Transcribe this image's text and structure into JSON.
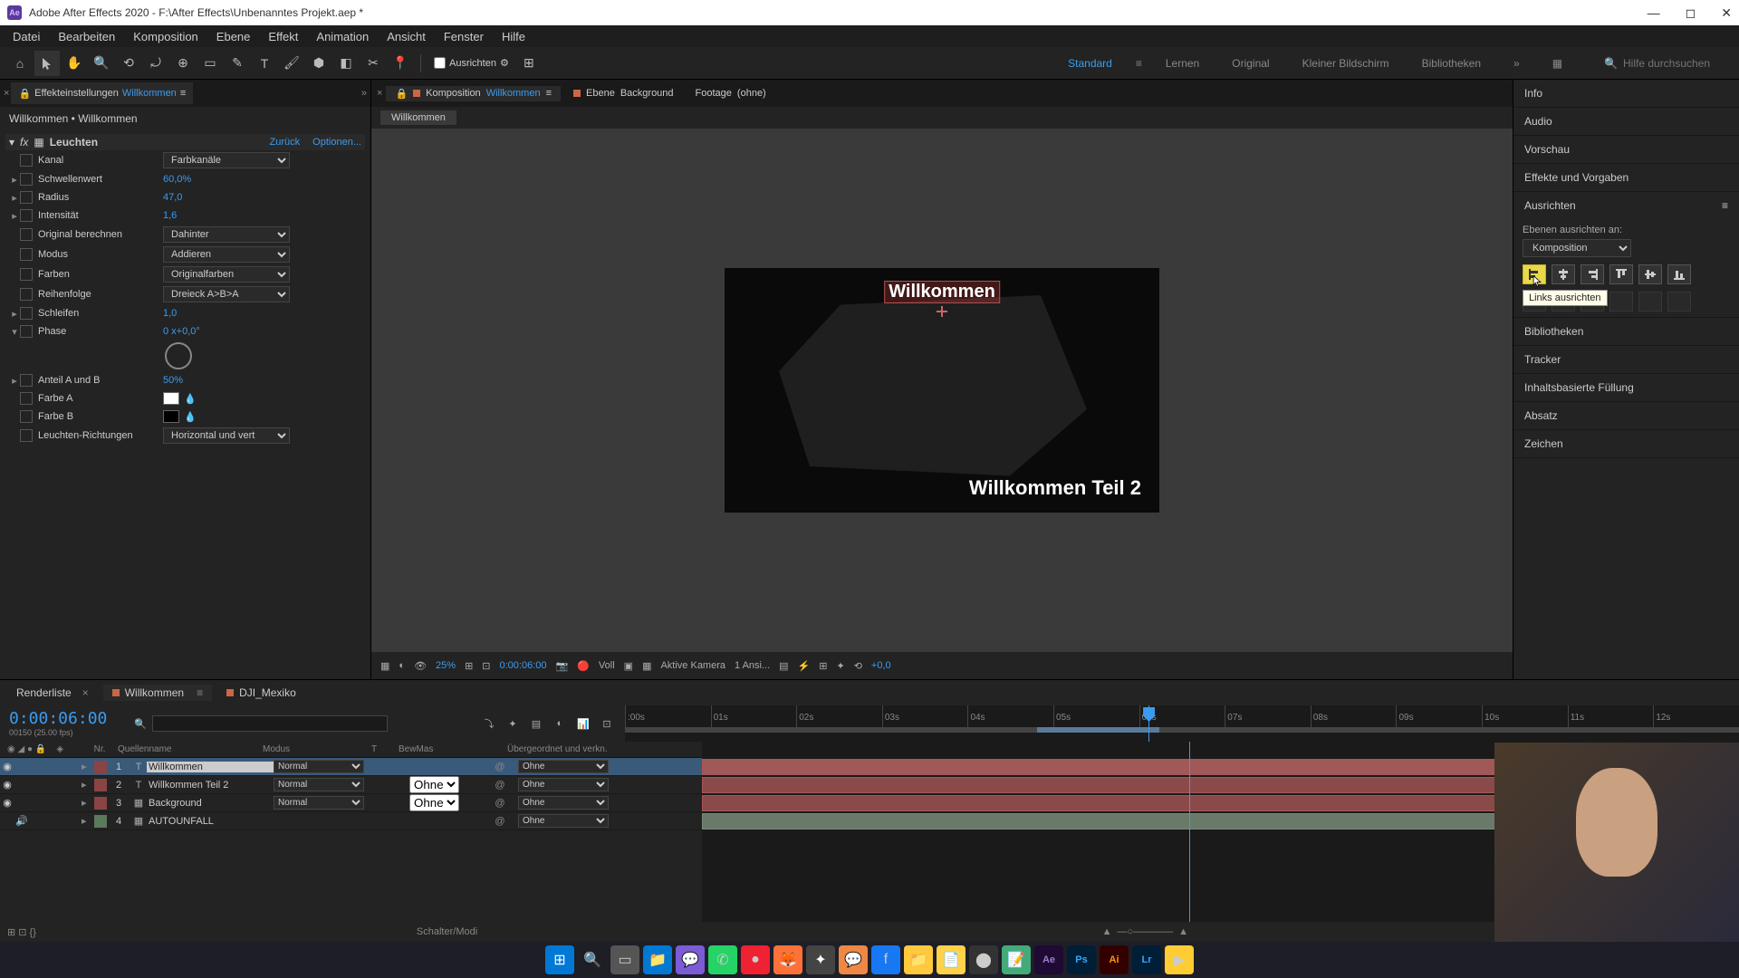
{
  "window": {
    "title": "Adobe After Effects 2020 - F:\\After Effects\\Unbenanntes Projekt.aep *"
  },
  "menu": [
    "Datei",
    "Bearbeiten",
    "Komposition",
    "Ebene",
    "Effekt",
    "Animation",
    "Ansicht",
    "Fenster",
    "Hilfe"
  ],
  "toolbar": {
    "snapping": "Ausrichten",
    "workspaces": [
      "Standard",
      "Lernen",
      "Original",
      "Kleiner Bildschirm",
      "Bibliotheken"
    ],
    "active_workspace": "Standard",
    "search_placeholder": "Hilfe durchsuchen"
  },
  "effect_panel": {
    "tab_prefix": "Effekteinstellungen",
    "tab_link": "Willkommen",
    "breadcrumb": "Willkommen • Willkommen",
    "effect_name": "Leuchten",
    "reset": "Zurück",
    "options": "Optionen...",
    "props": {
      "kanal": {
        "label": "Kanal",
        "value": "Farbkanäle"
      },
      "schwellenwert": {
        "label": "Schwellenwert",
        "value": "60,0%"
      },
      "radius": {
        "label": "Radius",
        "value": "47,0"
      },
      "intensitaet": {
        "label": "Intensität",
        "value": "1,6"
      },
      "original": {
        "label": "Original berechnen",
        "value": "Dahinter"
      },
      "modus": {
        "label": "Modus",
        "value": "Addieren"
      },
      "farben": {
        "label": "Farben",
        "value": "Originalfarben"
      },
      "reihenfolge": {
        "label": "Reihenfolge",
        "value": "Dreieck A>B>A"
      },
      "schleifen": {
        "label": "Schleifen",
        "value": "1,0"
      },
      "phase": {
        "label": "Phase",
        "value": "0 x+0,0°"
      },
      "anteil": {
        "label": "Anteil A und B",
        "value": "50%"
      },
      "farbeA": {
        "label": "Farbe A",
        "color": "#ffffff"
      },
      "farbeB": {
        "label": "Farbe B",
        "color": "#000000"
      },
      "richtungen": {
        "label": "Leuchten-Richtungen",
        "value": "Horizontal und vert"
      }
    }
  },
  "center": {
    "tabs": [
      {
        "prefix": "Komposition",
        "name": "Willkommen",
        "active": true
      },
      {
        "prefix": "Ebene",
        "name": "Background",
        "active": false
      },
      {
        "prefix": "Footage",
        "name": "(ohne)",
        "active": false
      }
    ],
    "breadcrumb": "Willkommen",
    "text1": "Willkommen",
    "text2": "Willkommen Teil 2",
    "controls": {
      "zoom": "25%",
      "timecode": "0:00:06:00",
      "resolution": "Voll",
      "camera": "Aktive Kamera",
      "views": "1 Ansi...",
      "exposure": "+0,0"
    }
  },
  "right": {
    "sections": [
      "Info",
      "Audio",
      "Vorschau",
      "Effekte und Vorgaben",
      "Ausrichten",
      "Bibliotheken",
      "Tracker",
      "Inhaltsbasierte Füllung",
      "Absatz",
      "Zeichen"
    ],
    "align": {
      "label": "Ebenen ausrichten an:",
      "target": "Komposition",
      "tooltip": "Links ausrichten"
    }
  },
  "timeline": {
    "tabs": [
      {
        "name": "Renderliste",
        "active": false
      },
      {
        "name": "Willkommen",
        "active": true
      },
      {
        "name": "DJI_Mexiko",
        "active": false
      }
    ],
    "timecode": "0:00:06:00",
    "timecode_sub": "00150 (25.00 fps)",
    "columns": {
      "nr": "Nr.",
      "name": "Quellenname",
      "mode": "Modus",
      "t": "T",
      "bewmas": "BewMas",
      "parent": "Übergeordnet und verkn."
    },
    "ruler": [
      ":00s",
      "01s",
      "02s",
      "03s",
      "04s",
      "05s",
      "06s",
      "07s",
      "08s",
      "09s",
      "10s",
      "11s",
      "12s"
    ],
    "layers": [
      {
        "num": 1,
        "type": "T",
        "name": "Willkommen",
        "mode": "Normal",
        "trk": "",
        "parent": "Ohne",
        "color": "#8a4444",
        "selected": true,
        "eye": true
      },
      {
        "num": 2,
        "type": "T",
        "name": "Willkommen Teil 2",
        "mode": "Normal",
        "trk": "Ohne",
        "parent": "Ohne",
        "color": "#8a4444",
        "eye": true
      },
      {
        "num": 3,
        "type": "",
        "name": "Background",
        "mode": "Normal",
        "trk": "Ohne",
        "parent": "Ohne",
        "color": "#8a4444",
        "eye": true
      },
      {
        "num": 4,
        "type": "",
        "name": "AUTOUNFALL",
        "mode": "",
        "trk": "",
        "parent": "Ohne",
        "color": "#5a7a5a",
        "audio": true
      }
    ],
    "footer": "Schalter/Modi"
  }
}
